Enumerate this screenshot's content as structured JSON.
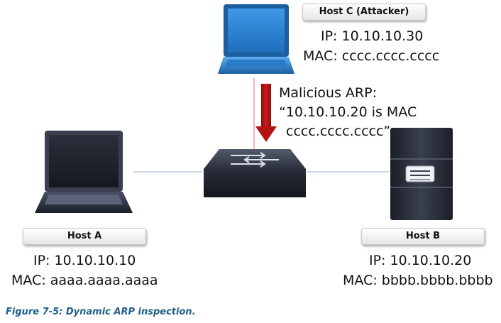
{
  "host_c": {
    "label": "Host C (Attacker)",
    "ip": "IP: 10.10.10.30",
    "mac": "MAC: cccc.cccc.cccc"
  },
  "host_a": {
    "label": "Host A",
    "ip": "IP: 10.10.10.10",
    "mac": "MAC: aaaa.aaaa.aaaa"
  },
  "host_b": {
    "label": "Host B",
    "ip": "IP: 10.10.10.20",
    "mac": "MAC: bbbb.bbbb.bbbb"
  },
  "attack": {
    "line1": "Malicious ARP:",
    "line2": "“10.10.10.20 is MAC",
    "line3": "cccc.cccc.cccc”"
  },
  "caption": "Figure 7-5: Dynamic ARP inspection.",
  "colors": {
    "attacker_laptop": "#2f86d6",
    "arrow": "#c81414",
    "link_line": "#b7c9dd",
    "caption": "#1f5f8b"
  },
  "icons": {
    "host_c": "laptop-icon",
    "host_a": "laptop-icon",
    "switch": "switch-icon",
    "host_b": "server-icon"
  }
}
